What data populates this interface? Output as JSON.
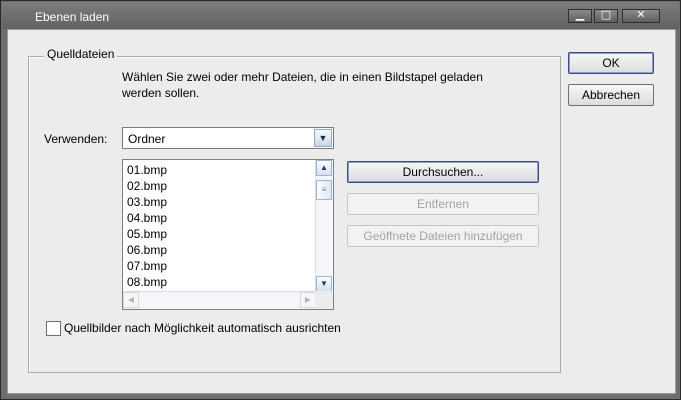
{
  "window": {
    "title": "Ebenen laden",
    "controls": [
      "minimize-icon",
      "maximize-icon",
      "close-icon"
    ]
  },
  "group": {
    "title": "Quelldateien",
    "description": "Wählen Sie zwei oder mehr Dateien, die in einen Bildstapel geladen werden sollen.",
    "use_label": "Verwenden:",
    "use_value": "Ordner",
    "files": [
      "01.bmp",
      "02.bmp",
      "03.bmp",
      "04.bmp",
      "05.bmp",
      "06.bmp",
      "07.bmp",
      "08.bmp"
    ]
  },
  "buttons": {
    "ok": "OK",
    "cancel": "Abbrechen",
    "browse": "Durchsuchen...",
    "remove": "Entfernen",
    "add_open": "Geöffnete Dateien hinzufügen"
  },
  "option": {
    "label": "Quellbilder nach Möglichkeit automatisch ausrichten",
    "checked": false
  }
}
